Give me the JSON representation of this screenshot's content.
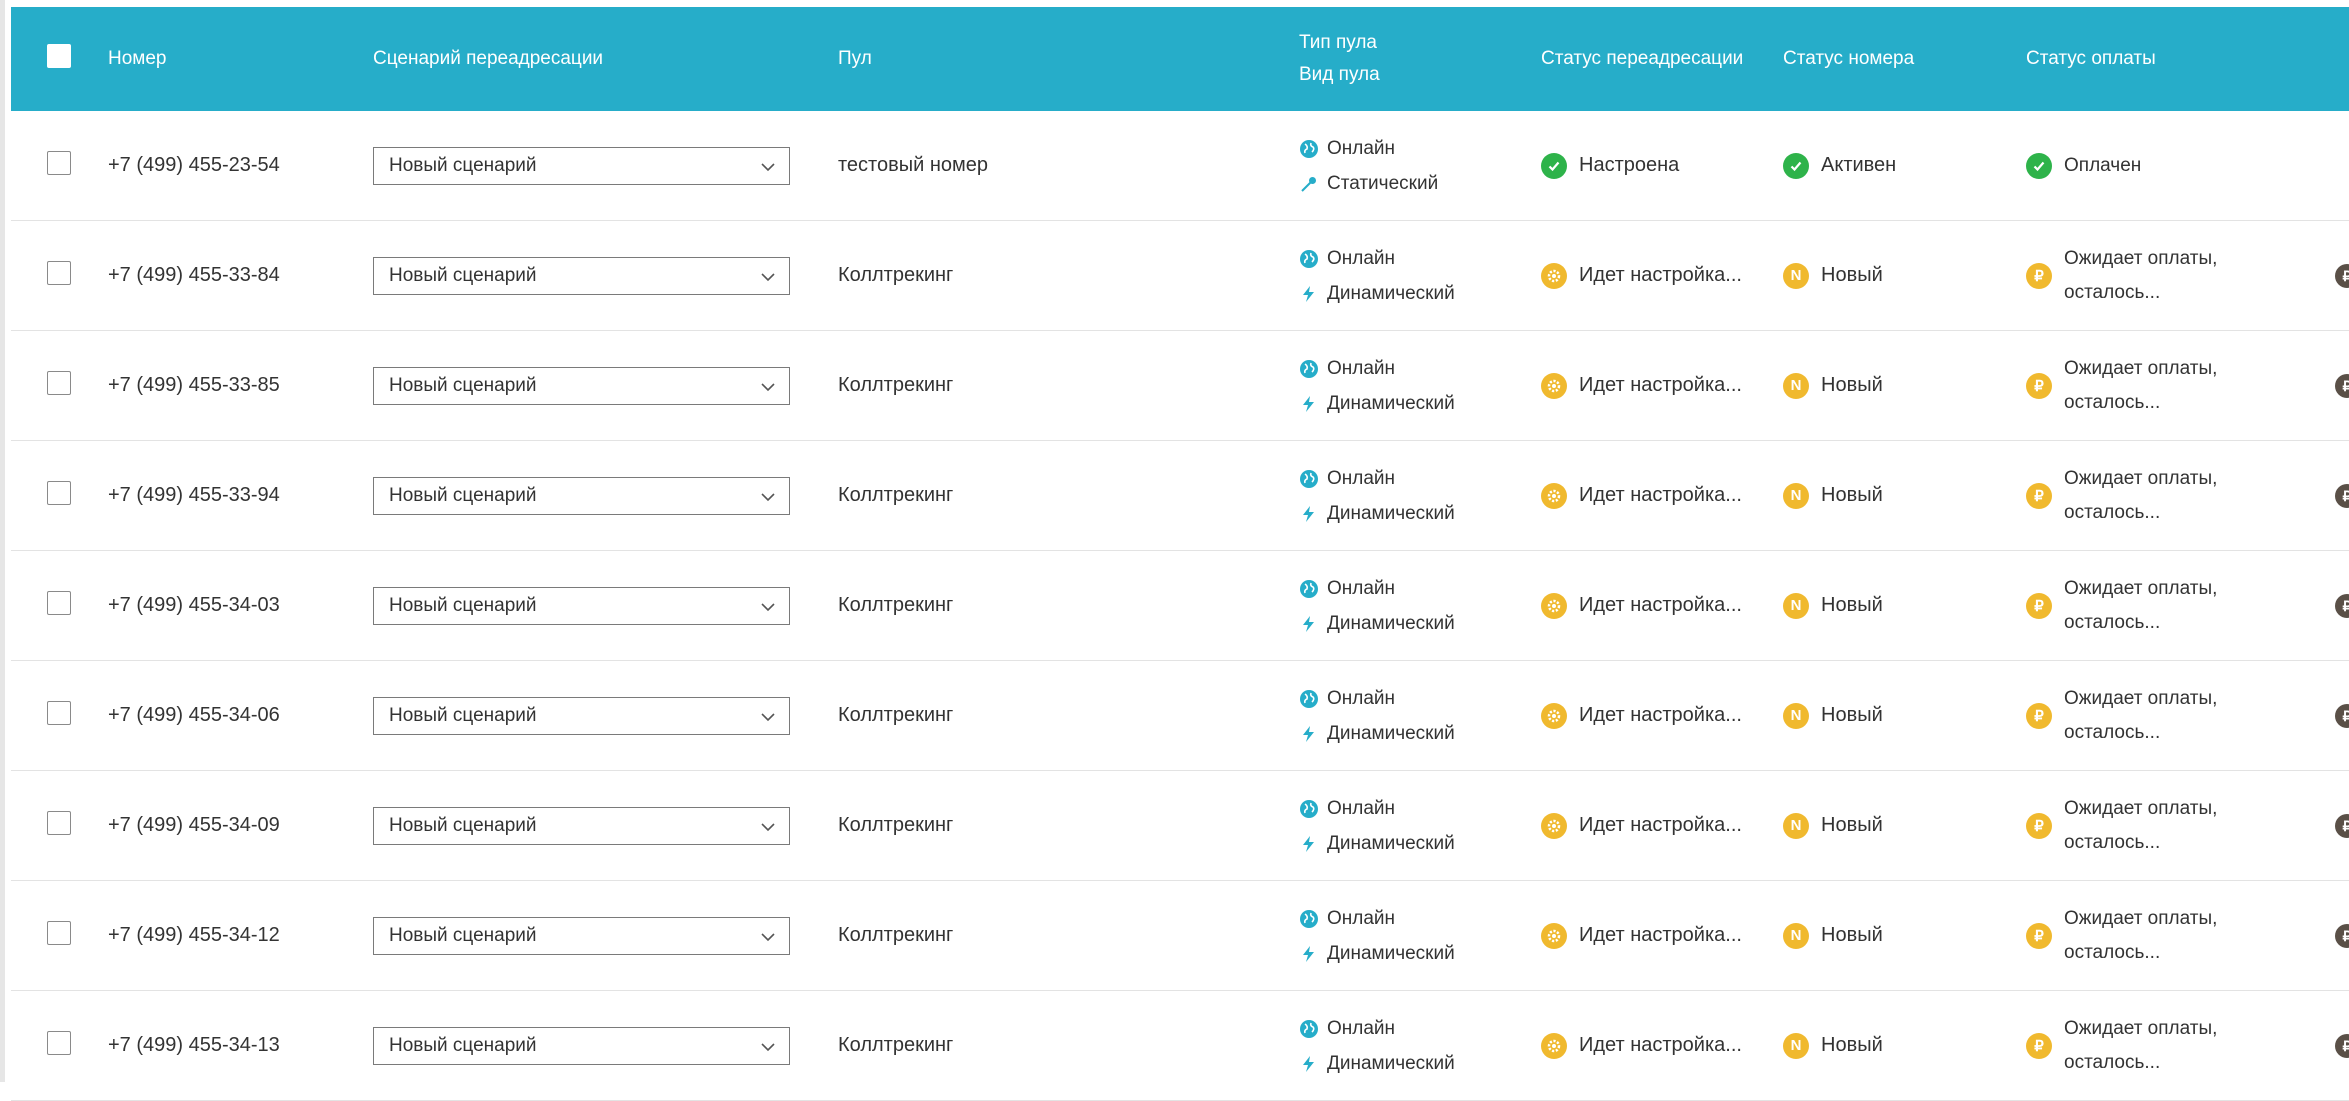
{
  "header": {
    "number": "Номер",
    "scenario": "Сценарий переадресации",
    "pool": "Пул",
    "pool_type": "Тип пула",
    "pool_kind": "Вид пула",
    "forward_status": "Статус переадресации",
    "number_status": "Статус номера",
    "payment_status": "Статус оплаты"
  },
  "colors": {
    "header_bg": "#26adc9",
    "ok": "#2eb34a",
    "warn": "#f0b92e",
    "online": "#26adc9",
    "dark": "#5a5047"
  },
  "rows": [
    {
      "number": "+7 (499) 455-23-54",
      "scenario": "Новый сценарий",
      "pool": "тестовый номер",
      "pool_type": "Онлайн",
      "pool_kind": "Статический",
      "forward_status": "Настроена",
      "number_status": "Активен",
      "payment_line1": "Оплачен",
      "payment_line2": ""
    },
    {
      "number": "+7 (499) 455-33-84",
      "scenario": "Новый сценарий",
      "pool": "Коллтрекинг",
      "pool_type": "Онлайн",
      "pool_kind": "Динамический",
      "forward_status": "Идет настройка...",
      "number_status": "Новый",
      "payment_line1": "Ожидает оплаты,",
      "payment_line2": "осталось..."
    },
    {
      "number": "+7 (499) 455-33-85",
      "scenario": "Новый сценарий",
      "pool": "Коллтрекинг",
      "pool_type": "Онлайн",
      "pool_kind": "Динамический",
      "forward_status": "Идет настройка...",
      "number_status": "Новый",
      "payment_line1": "Ожидает оплаты,",
      "payment_line2": "осталось..."
    },
    {
      "number": "+7 (499) 455-33-94",
      "scenario": "Новый сценарий",
      "pool": "Коллтрекинг",
      "pool_type": "Онлайн",
      "pool_kind": "Динамический",
      "forward_status": "Идет настройка...",
      "number_status": "Новый",
      "payment_line1": "Ожидает оплаты,",
      "payment_line2": "осталось..."
    },
    {
      "number": "+7 (499) 455-34-03",
      "scenario": "Новый сценарий",
      "pool": "Коллтрекинг",
      "pool_type": "Онлайн",
      "pool_kind": "Динамический",
      "forward_status": "Идет настройка...",
      "number_status": "Новый",
      "payment_line1": "Ожидает оплаты,",
      "payment_line2": "осталось..."
    },
    {
      "number": "+7 (499) 455-34-06",
      "scenario": "Новый сценарий",
      "pool": "Коллтрекинг",
      "pool_type": "Онлайн",
      "pool_kind": "Динамический",
      "forward_status": "Идет настройка...",
      "number_status": "Новый",
      "payment_line1": "Ожидает оплаты,",
      "payment_line2": "осталось..."
    },
    {
      "number": "+7 (499) 455-34-09",
      "scenario": "Новый сценарий",
      "pool": "Коллтрекинг",
      "pool_type": "Онлайн",
      "pool_kind": "Динамический",
      "forward_status": "Идет настройка...",
      "number_status": "Новый",
      "payment_line1": "Ожидает оплаты,",
      "payment_line2": "осталось..."
    },
    {
      "number": "+7 (499) 455-34-12",
      "scenario": "Новый сценарий",
      "pool": "Коллтрекинг",
      "pool_type": "Онлайн",
      "pool_kind": "Динамический",
      "forward_status": "Идет настройка...",
      "number_status": "Новый",
      "payment_line1": "Ожидает оплаты,",
      "payment_line2": "осталось..."
    },
    {
      "number": "+7 (499) 455-34-13",
      "scenario": "Новый сценарий",
      "pool": "Коллтрекинг",
      "pool_type": "Онлайн",
      "pool_kind": "Динамический",
      "forward_status": "Идет настройка...",
      "number_status": "Новый",
      "payment_line1": "Ожидает оплаты,",
      "payment_line2": "осталось..."
    }
  ]
}
